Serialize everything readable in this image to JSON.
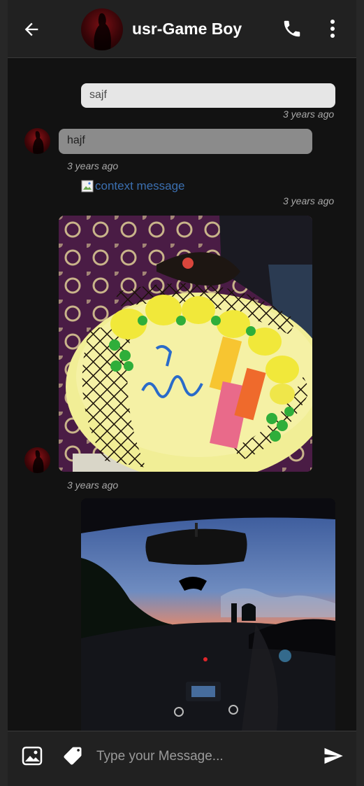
{
  "header": {
    "title": "usr-Game Boy",
    "back_icon": "arrow-left-icon",
    "call_icon": "phone-icon",
    "more_icon": "more-vertical-icon"
  },
  "messages": [
    {
      "direction": "outgoing",
      "type": "text",
      "text": "sajf",
      "time": "3 years ago"
    },
    {
      "direction": "incoming",
      "type": "text",
      "text": "hajf",
      "time": "3 years ago"
    },
    {
      "direction": "outgoing",
      "type": "image",
      "alt": "context message",
      "time": "3 years ago"
    },
    {
      "direction": "incoming",
      "type": "image",
      "subject": "birthday cake photo",
      "time": "3 years ago"
    },
    {
      "direction": "outgoing",
      "type": "image",
      "subject": "car dashboard at dusk photo"
    }
  ],
  "composer": {
    "placeholder": "Type your Message...",
    "photo_icon": "image-icon",
    "tag_icon": "tag-icon",
    "send_icon": "send-icon"
  },
  "colors": {
    "background": "#121212",
    "bar": "#212121",
    "outgoing_bubble": "#e6e6e6",
    "incoming_bubble": "#8b8b8b",
    "link": "#3b6fb0"
  }
}
